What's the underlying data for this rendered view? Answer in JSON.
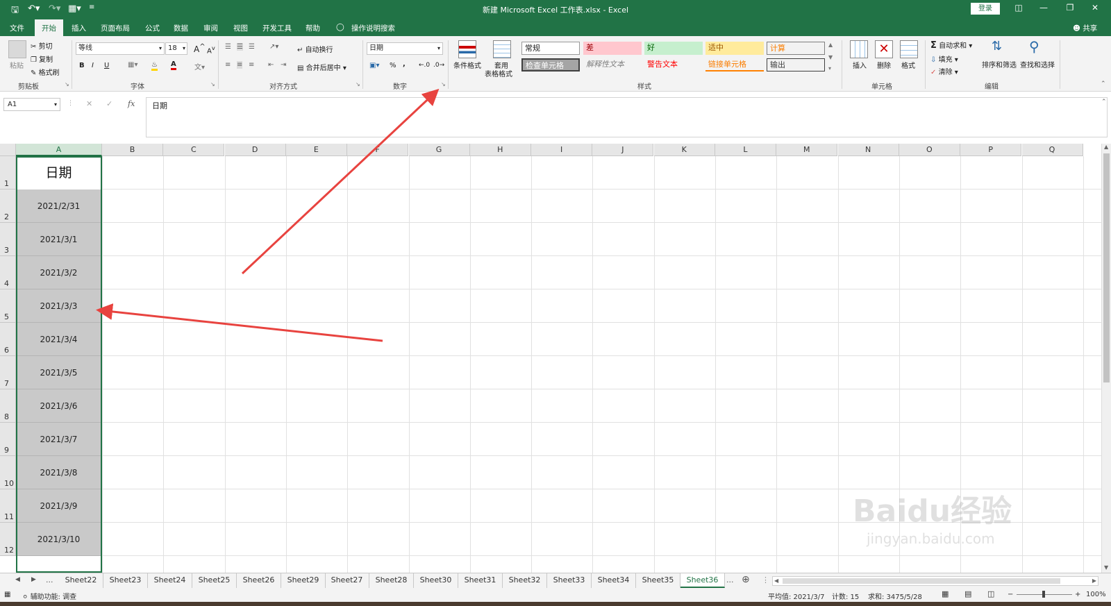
{
  "window": {
    "title": "新建 Microsoft Excel 工作表.xlsx  -  Excel",
    "login": "登录",
    "share": "共享"
  },
  "menu": {
    "tabs": [
      "文件",
      "开始",
      "插入",
      "页面布局",
      "公式",
      "数据",
      "审阅",
      "视图",
      "开发工具",
      "帮助"
    ],
    "active": "开始",
    "tell_me": "操作说明搜索"
  },
  "ribbon": {
    "clipboard": {
      "paste": "粘贴",
      "cut": "剪切",
      "copy": "复制",
      "format_painter": "格式刷",
      "label": "剪贴板"
    },
    "font": {
      "name": "等线",
      "size": "18",
      "label": "字体",
      "bold": "B",
      "italic": "I",
      "underline": "U",
      "grow": "A",
      "shrink": "A"
    },
    "alignment": {
      "wrap": "自动换行",
      "merge": "合并后居中",
      "label": "对齐方式"
    },
    "number": {
      "format": "日期",
      "label": "数字",
      "percent": "%",
      "comma": ","
    },
    "styles": {
      "conditional": "条件格式",
      "table_format_1": "套用",
      "table_format_2": "表格格式",
      "label": "样式",
      "cells": [
        "常规",
        "差",
        "好",
        "适中",
        "计算",
        "检查单元格",
        "解释性文本",
        "警告文本",
        "链接单元格",
        "输出"
      ]
    },
    "cells_group": {
      "insert": "插入",
      "delete": "删除",
      "format": "格式",
      "label": "单元格"
    },
    "editing": {
      "autosum": "自动求和",
      "fill": "填充",
      "clear": "清除",
      "sort": "排序和筛选",
      "find": "查找和选择",
      "label": "编辑"
    }
  },
  "formula_bar": {
    "name_box": "A1",
    "fx": "fx",
    "content": "日期"
  },
  "grid": {
    "columns": [
      "A",
      "B",
      "C",
      "D",
      "E",
      "F",
      "G",
      "H",
      "I",
      "J",
      "K",
      "L",
      "M",
      "N",
      "O",
      "P",
      "Q"
    ],
    "rows": [
      "1",
      "2",
      "3",
      "4",
      "5",
      "6",
      "7",
      "8",
      "9",
      "10",
      "11",
      "12"
    ],
    "header": "日期",
    "dates": [
      "2021/2/31",
      "2021/3/1",
      "2021/3/2",
      "2021/3/3",
      "2021/3/4",
      "2021/3/5",
      "2021/3/6",
      "2021/3/7",
      "2021/3/8",
      "2021/3/9",
      "2021/3/10"
    ]
  },
  "sheets": {
    "ellipsis": "...",
    "tabs": [
      "Sheet22",
      "Sheet23",
      "Sheet24",
      "Sheet25",
      "Sheet26",
      "Sheet29",
      "Sheet27",
      "Sheet28",
      "Sheet30",
      "Sheet31",
      "Sheet32",
      "Sheet33",
      "Sheet34",
      "Sheet35",
      "Sheet36"
    ],
    "active": "Sheet36"
  },
  "status": {
    "accessibility": "辅助功能: 调查",
    "average": "平均值: 2021/3/7",
    "count": "计数: 15",
    "sum": "求和: 3475/5/28",
    "zoom": "100%"
  },
  "watermark": {
    "brand": "Baidu经验",
    "url": "jingyan.baidu.com"
  },
  "colors": {
    "accent": "#217346",
    "arrow": "#e8433f",
    "cell_fill": "#c9c9c9"
  }
}
